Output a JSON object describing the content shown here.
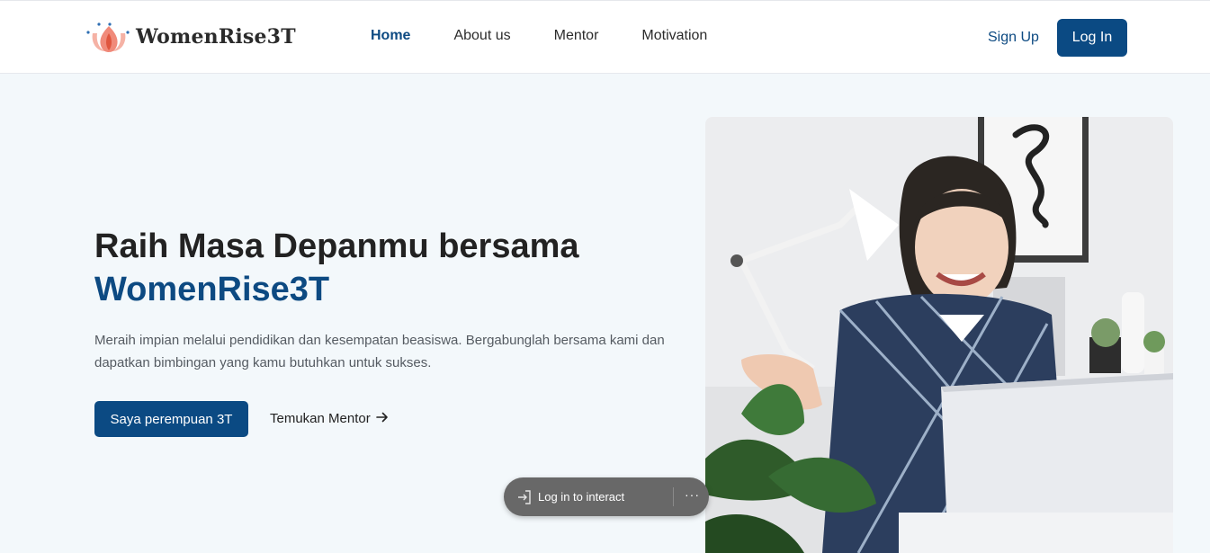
{
  "colors": {
    "accent": "#0b4a83",
    "accent_text": "#0d4a82",
    "page_bg": "#f3f8fb",
    "heading": "#222222",
    "body_text": "#555b62",
    "logo_petal": "#f08a7a",
    "logo_dots": "#2f6fb3"
  },
  "brand": {
    "name": "WomenRise3T",
    "logo_icon": "lotus-flower-icon"
  },
  "nav": {
    "items": [
      {
        "label": "Home",
        "active": true
      },
      {
        "label": "About us",
        "active": false
      },
      {
        "label": "Mentor",
        "active": false
      },
      {
        "label": "Motivation",
        "active": false
      }
    ],
    "signup_label": "Sign Up",
    "login_label": "Log In"
  },
  "hero": {
    "title_line1": "Raih Masa Depanmu bersama",
    "title_line2": "WomenRise3T",
    "description": "Meraih impian melalui pendidikan dan kesempatan beasiswa. Bergabunglah bersama kami dan dapatkan bimbingan yang kamu butuhkan untuk sukses.",
    "primary_button": "Saya perempuan 3T",
    "secondary_link": "Temukan Mentor",
    "secondary_icon": "arrow-right-icon",
    "image_alt": "woman-smiling-at-laptop-photo"
  },
  "overlay_pill": {
    "icon": "sign-in-icon",
    "label": "Log in to interact",
    "more_label": "···"
  }
}
